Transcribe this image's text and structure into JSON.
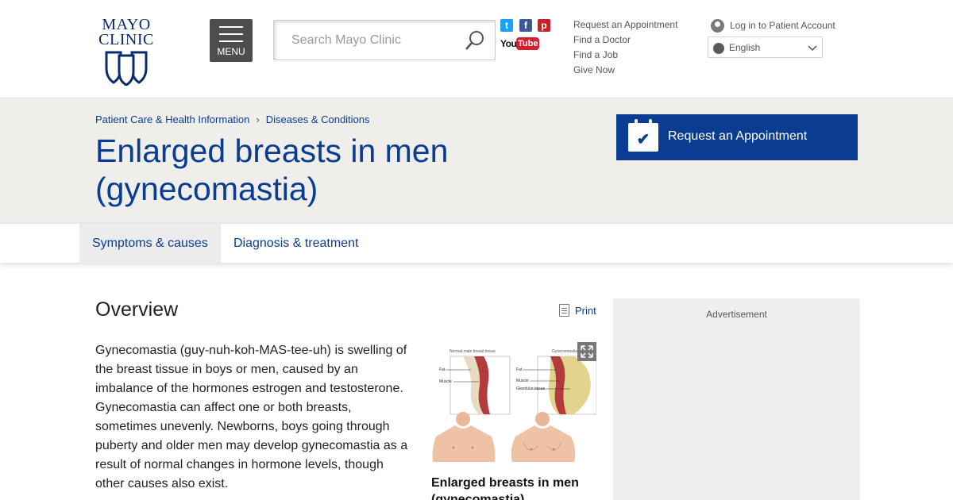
{
  "header": {
    "logo_line1": "MAYO",
    "logo_line2": "CLINIC",
    "menu_label": "MENU",
    "search_placeholder": "Search Mayo Clinic",
    "social": [
      {
        "name": "twitter",
        "glyph": "t",
        "color": "#1da1f2"
      },
      {
        "name": "facebook",
        "glyph": "f",
        "color": "#3b5998"
      },
      {
        "name": "pinterest",
        "glyph": "p",
        "color": "#cb2027"
      }
    ],
    "youtube": {
      "you": "You",
      "tube": "Tube"
    },
    "util_links": [
      "Request an Appointment",
      "Find a Doctor",
      "Find a Job",
      "Give Now"
    ],
    "login_label": "Log in to Patient Account",
    "language": "English"
  },
  "banner": {
    "breadcrumbs": [
      "Patient Care & Health Information",
      "Diseases & Conditions"
    ],
    "breadcrumb_sep": "›",
    "title": "Enlarged breasts in men (gynecomastia)",
    "appointment_label": "Request an Appointment"
  },
  "tabs": [
    "Symptoms & causes",
    "Diagnosis & treatment"
  ],
  "content": {
    "section_title": "Overview",
    "print_label": "Print",
    "paragraph": "Gynecomastia (guy-nuh-koh-MAS-tee-uh) is swelling of the breast tissue in boys or men, caused by an imbalance of the hormones estrogen and testosterone. Gynecomastia can affect one or both breasts, sometimes unevenly. Newborns, boys going through puberty and older men may develop gynecomastia as a result of normal changes in hormone levels, though other causes also exist.",
    "figure": {
      "left_heading": "Normal male breast tissue",
      "right_heading": "Gynecomastia",
      "left_labels": [
        "Fat",
        "Muscle"
      ],
      "right_labels": [
        "Fat",
        "Muscle",
        "Glandular tissue"
      ],
      "caption": "Enlarged breasts in men (gynecomastia)"
    },
    "ad_label": "Advertisement"
  },
  "colors": {
    "brand_blue": "#0a3d91",
    "banner_bg": "#efeeea",
    "menu_bg": "#4d4d4d"
  }
}
